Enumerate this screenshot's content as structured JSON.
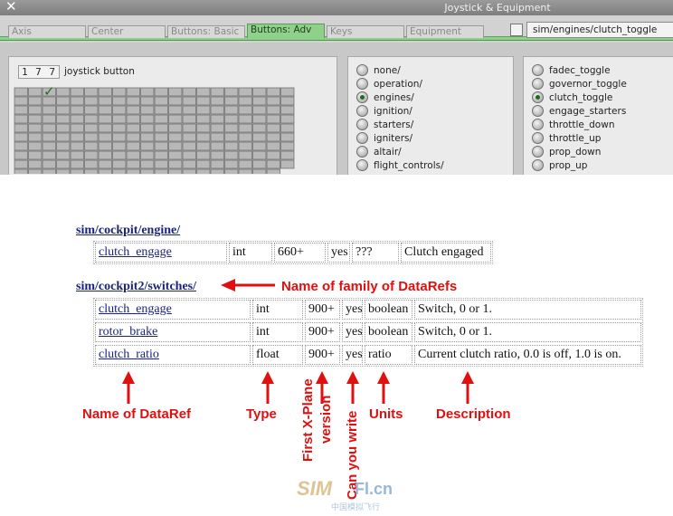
{
  "window": {
    "title": "Joystick & Equipment",
    "close_glyph": "✕"
  },
  "tabs": [
    {
      "label": "Axis"
    },
    {
      "label": "Center"
    },
    {
      "label": "Buttons: Basic"
    },
    {
      "label": "Buttons: Adv",
      "active": true
    },
    {
      "label": "Keys"
    },
    {
      "label": "Equipment"
    }
  ],
  "search": {
    "value": "sim/engines/clutch_toggle"
  },
  "button_panel": {
    "number": "1 7 7",
    "label": "joystick button",
    "checkmark": "✓"
  },
  "category_list": {
    "items": [
      "none/",
      "operation/",
      "engines/",
      "ignition/",
      "starters/",
      "igniters/",
      "altair/",
      "flight_controls/"
    ],
    "selected": "engines/"
  },
  "command_list": {
    "items": [
      "fadec_toggle",
      "governor_toggle",
      "clutch_toggle",
      "engage_starters",
      "throttle_down",
      "throttle_up",
      "prop_down",
      "prop_up"
    ],
    "selected": "clutch_toggle"
  },
  "doc": {
    "family1": {
      "header": "sim/cockpit/engine/",
      "rows": [
        {
          "name": "clutch_engage",
          "type": "int",
          "version": "660+",
          "writable": "yes",
          "units": "???",
          "description": "Clutch engaged"
        }
      ]
    },
    "family2": {
      "header": "sim/cockpit2/switches/",
      "rows": [
        {
          "name": "clutch_engage",
          "type": "int",
          "version": "900+",
          "writable": "yes",
          "units": "boolean",
          "description": "Switch, 0 or 1."
        },
        {
          "name": "rotor_brake",
          "type": "int",
          "version": "900+",
          "writable": "yes",
          "units": "boolean",
          "description": "Switch, 0 or 1."
        },
        {
          "name": "clutch_ratio",
          "type": "float",
          "version": "900+",
          "writable": "yes",
          "units": "ratio",
          "description": "Current clutch ratio, 0.0 is off, 1.0 is on."
        }
      ]
    }
  },
  "annotations": {
    "family": "Name of family of DataRefs",
    "name": "Name of DataRef",
    "type": "Type",
    "version_line1": "First X-Plane",
    "version_line2": "version",
    "writable": "Can you write",
    "units": "Units",
    "description": "Description",
    "color": "#e01010"
  },
  "watermark": {
    "left": "SIM",
    "right": "Fl.cn",
    "sub": "中国模拟飞行"
  }
}
